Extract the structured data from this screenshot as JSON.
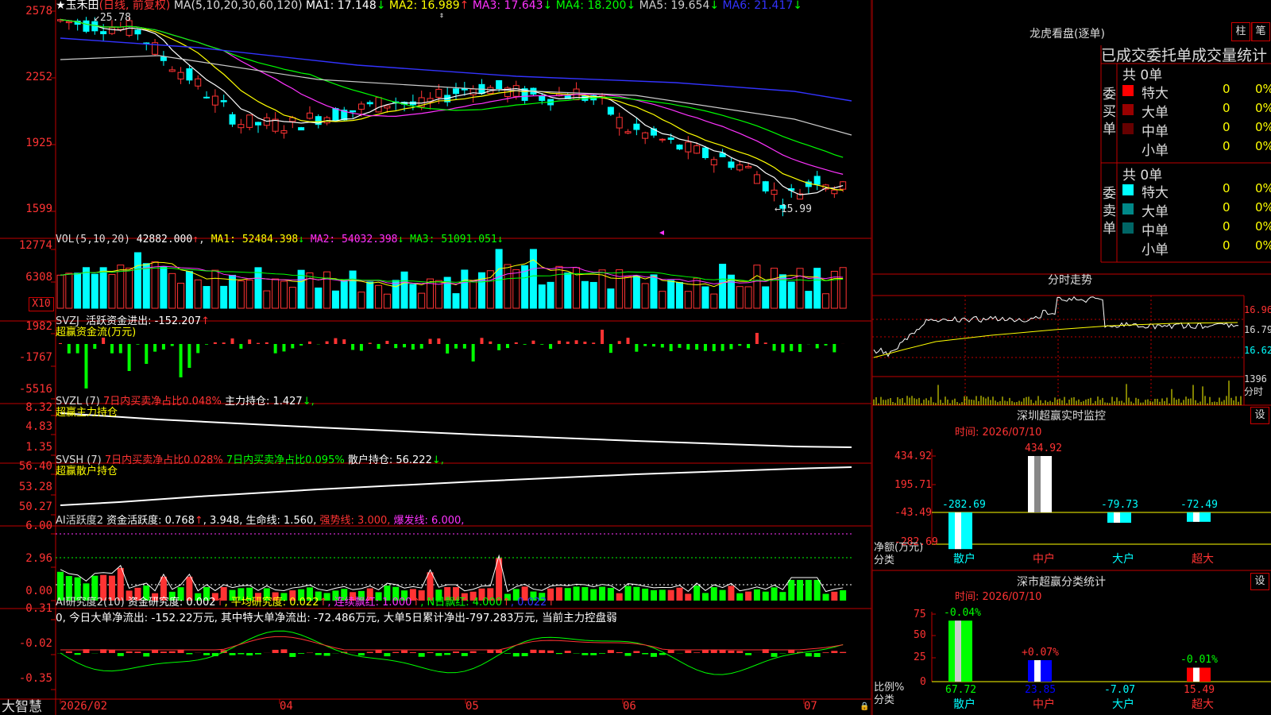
{
  "colors": {
    "up": "#ff3333",
    "down": "#00ffff",
    "grid": "#c00000",
    "ma1": "#ffffff",
    "ma2": "#ffff00",
    "ma3": "#ff33ff",
    "ma4": "#00ff00",
    "ma5": "#cccccc",
    "ma6": "#3333ff"
  },
  "main": {
    "star": "★",
    "stock_name": "玉禾田",
    "period": "(日线, 前复权)",
    "ma_params": "MA(5,10,20,30,60,120)",
    "ma": [
      {
        "label": "MA1: 17.148",
        "arrow": "↓",
        "color": "#ffffff"
      },
      {
        "label": "MA2: 16.989",
        "arrow": "↑",
        "color": "#ffff00"
      },
      {
        "label": "MA3: 17.643",
        "arrow": "↓",
        "color": "#ff33ff"
      },
      {
        "label": "MA4: 18.200",
        "arrow": "↓",
        "color": "#00ff00"
      },
      {
        "label": "MA5: 19.654",
        "arrow": "↓",
        "color": "#cccccc"
      },
      {
        "label": "MA6: 21.417",
        "arrow": "↓",
        "color": "#3333ff"
      }
    ],
    "y_labels": [
      "2578",
      "2252",
      "1925",
      "1599"
    ],
    "high_mark": "25.78",
    "low_mark": "15.99"
  },
  "vol": {
    "name": "VOL(5,10,20)",
    "value": "42882.000",
    "arrow": "↑",
    "ma": [
      {
        "label": "MA1: 52484.398",
        "arrow": "↓",
        "color": "#ffff00"
      },
      {
        "label": "MA2: 54032.398",
        "arrow": "↓",
        "color": "#ff33ff"
      },
      {
        "label": "MA3: 51091.051",
        "arrow": "↓",
        "color": "#00ff00"
      }
    ],
    "y_labels": [
      "12774",
      "6308"
    ],
    "unit": "X10"
  },
  "svzj": {
    "name": "SVZJ",
    "desc": "活跃资金进出: -152.207",
    "arrow": "↑",
    "sub": "超赢资金流(万元)",
    "y_labels": [
      "1982",
      "-1767",
      "-5516"
    ]
  },
  "svzl": {
    "name": "SVZL (7)",
    "red": "7日内买卖净占比0.048%",
    "white": "主力持仓: 1.427",
    "arrow": "↓,",
    "sub": "超赢主力持仓",
    "y_labels": [
      "8.32",
      "4.83",
      "1.35"
    ]
  },
  "svsh": {
    "name": "SVSH (7)",
    "red": "7日内买卖净占比0.028%",
    "green": "7日内买卖净占比0.095%",
    "white": "散户持仓: 56.222",
    "arrow": "↓,",
    "sub": "超赢散户持仓",
    "y_labels": [
      "56.40",
      "53.28",
      "50.27"
    ]
  },
  "aihy": {
    "name": "AI活跃度2",
    "t1": "资金活跃度: 0.768",
    "a1": "↑",
    "t2": ", 3.948, 生命线: 1.560,",
    "t3": "强势线: 3.000,",
    "t4": "爆发线: 6.000,",
    "y_labels": [
      "6.00",
      "2.96",
      "0.00"
    ]
  },
  "aiyj": {
    "name": "AI研究度2(10)",
    "t1": "资金研究度: 0.002",
    "a1": "↑",
    "t2": ", 平均研究度: 0.022",
    "a2": "↑",
    "t3": ", 连续飘红: 1.000",
    "a3": "↑",
    "t4": ", N日飘红: 4.000",
    "a4": "↑",
    "t5": ", 0.022",
    "a5": "↑",
    "line2": "0, 今日大单净流出: -152.22万元, 其中特大单净流出: -72.486万元, 大单5日累计净出-797.283万元, 当前主力控盘弱",
    "y_labels": [
      "0.31",
      "-0.02",
      "-0.35"
    ]
  },
  "xaxis": {
    "brand": "大智慧",
    "labels": [
      "2026/02",
      "04",
      "05",
      "06",
      "07"
    ]
  },
  "lhb": {
    "title": "龙虎看盘(逐单)",
    "btn1": "柱",
    "btn2": "笔",
    "subtitle": "已成交委托单成交量统计",
    "buy": {
      "side": "委买单",
      "total": "共 0单",
      "rows": [
        {
          "name": "特大",
          "v": "0",
          "p": "0%",
          "color": "#ff0000"
        },
        {
          "name": "大单",
          "v": "0",
          "p": "0%",
          "color": "#990000"
        },
        {
          "name": "中单",
          "v": "0",
          "p": "0%",
          "color": "#660000"
        },
        {
          "name": "小单",
          "v": "0",
          "p": "0%",
          "color": "#000000"
        }
      ]
    },
    "sell": {
      "side": "委卖单",
      "total": "共 0单",
      "rows": [
        {
          "name": "特大",
          "v": "0",
          "p": "0%",
          "color": "#00ffff"
        },
        {
          "name": "大单",
          "v": "0",
          "p": "0%",
          "color": "#008888"
        },
        {
          "name": "中单",
          "v": "0",
          "p": "0%",
          "color": "#006666"
        },
        {
          "name": "小单",
          "v": "0",
          "p": "0%",
          "color": "#000000"
        }
      ]
    }
  },
  "fs": {
    "title": "分时走势",
    "y_labels": [
      "16.96",
      "16.79",
      "16.62"
    ],
    "vol_label": "1396",
    "vol_unit": "分时"
  },
  "sz": {
    "title": "深圳超赢实时监控",
    "btn": "设",
    "date": "时间: 2026/07/10",
    "y_labels": [
      "434.92",
      "195.71",
      "-43.49",
      "-282.69"
    ],
    "ylabel1": "净额(万元)",
    "ylabel2": "分类",
    "categories": [
      "散户",
      "中户",
      "大户",
      "超大"
    ],
    "values": [
      -282.69,
      434.92,
      -79.73,
      -72.49
    ],
    "value_labels": [
      "-282.69",
      "434.92",
      "-79.73",
      "-72.49"
    ]
  },
  "szfl": {
    "title": "深市超赢分类统计",
    "btn": "设",
    "date": "时间: 2026/07/10",
    "y_labels": [
      "75",
      "50",
      "25",
      "0"
    ],
    "ylabel1": "比例%",
    "ylabel2": "分类",
    "categories": [
      "散户",
      "中户",
      "大户",
      "超大"
    ],
    "values": [
      67.72,
      23.85,
      -7.07,
      15.49
    ],
    "bottom_labels": [
      "67.72",
      "23.85",
      "-7.07",
      "15.49"
    ],
    "top_labels": [
      "-0.04%",
      "+0.07%",
      "",
      "-0.01%"
    ]
  }
}
